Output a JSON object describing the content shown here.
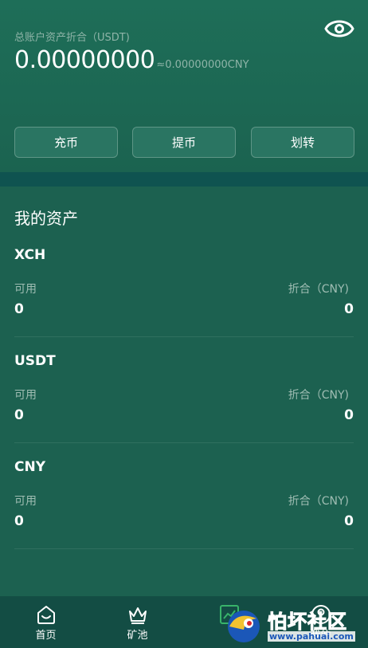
{
  "header": {
    "total_label": "总账户资产折合（USDT)",
    "total_value": "0.00000000",
    "total_cny": "≈0.00000000CNY"
  },
  "actions": {
    "recharge": "充币",
    "withdraw": "提币",
    "transfer": "划转"
  },
  "assets": {
    "title": "我的资产",
    "items": [
      {
        "name": "XCH",
        "available_label": "可用",
        "convert_label": "折合（CNY)",
        "available": "0",
        "converted": "0"
      },
      {
        "name": "USDT",
        "available_label": "可用",
        "convert_label": "折合（CNY)",
        "available": "0",
        "converted": "0"
      },
      {
        "name": "CNY",
        "available_label": "可用",
        "convert_label": "折合（CNY)",
        "available": "0",
        "converted": "0"
      }
    ]
  },
  "tabbar": {
    "home": "首页",
    "pool": "矿池",
    "mine": "我的"
  },
  "watermark": {
    "text": "怕坏社区",
    "url": "www.pahuai.com"
  },
  "colors": {
    "background": "#1d6150",
    "separator": "#0f5350",
    "tabbar": "#134d44",
    "muted_text": "#8fb4a8"
  },
  "icons": [
    "eye-icon",
    "home-icon",
    "crown-icon",
    "market-icon",
    "user-icon"
  ]
}
